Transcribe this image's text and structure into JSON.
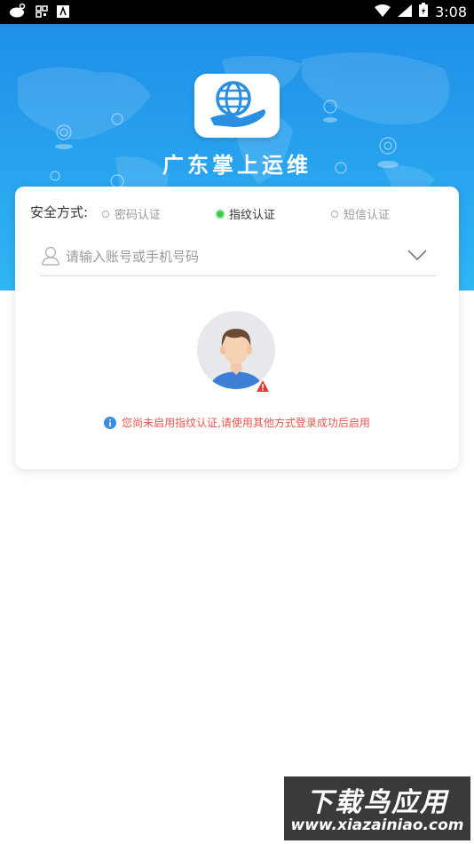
{
  "status_bar": {
    "time": "3:08",
    "left_icons": [
      "weibo-icon",
      "qr-icon",
      "text-icon"
    ],
    "right_icons": [
      "wifi-icon",
      "signal-icon",
      "battery-icon"
    ]
  },
  "app": {
    "title": "广东掌上运维",
    "logo_icon": "globe-hand-icon"
  },
  "login": {
    "security_label": "安全方式:",
    "options": [
      {
        "label": "密码认证",
        "selected": false
      },
      {
        "label": "指纹认证",
        "selected": true
      },
      {
        "label": "短信认证",
        "selected": false
      }
    ],
    "account_placeholder": "请输入账号或手机号码",
    "notice": "您尚未启用指纹认证,请使用其他方式登录成功后启用"
  },
  "colors": {
    "hero_blue": "#29a6ef",
    "selected_green": "#3ccf4e",
    "notice_red": "#e8554e",
    "info_blue": "#3b8de0"
  },
  "watermark": {
    "line1": "下载鸟应用",
    "line2": "www.xiazainiao.com"
  }
}
